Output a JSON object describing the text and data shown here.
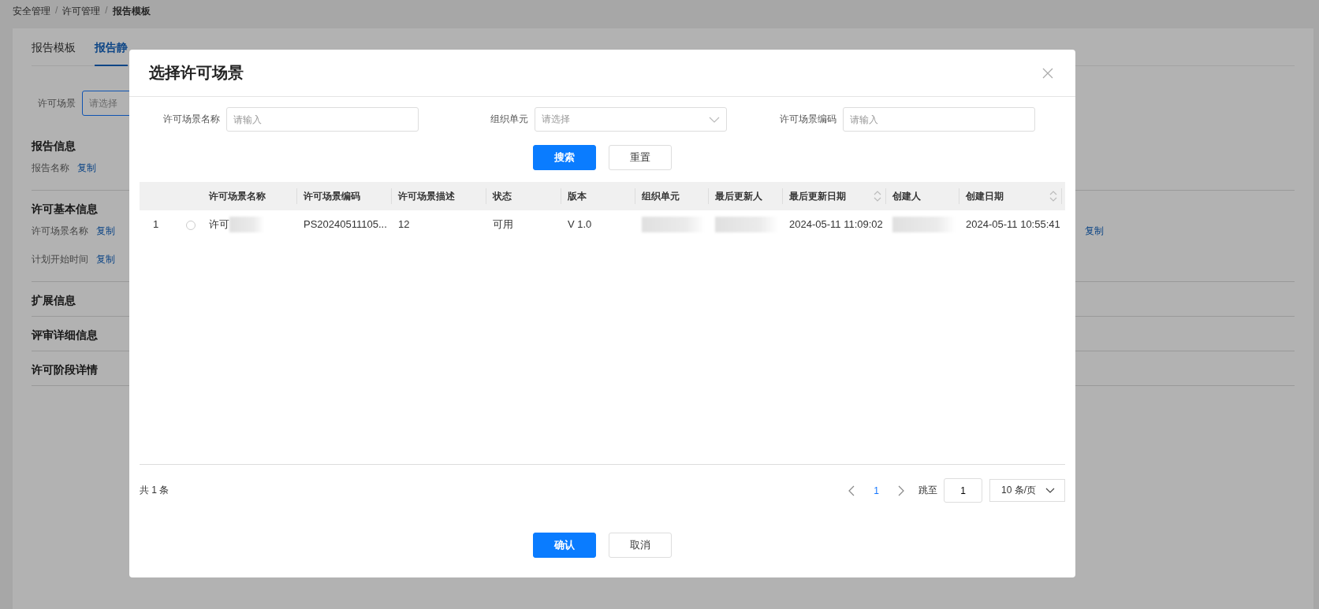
{
  "breadcrumb_separator": "/",
  "breadcrumb": [
    {
      "label": "安全管理",
      "current": false
    },
    {
      "label": "许可管理",
      "current": false
    },
    {
      "label": "报告模板",
      "current": true
    }
  ],
  "tabs": [
    {
      "label": "报告模板",
      "selected": false
    },
    {
      "label": "报告静",
      "selected": true
    }
  ],
  "filter": {
    "label": "许可场景",
    "placeholder": "请选择"
  },
  "sections": [
    {
      "title": "报告信息",
      "rows": [
        [
          {
            "kind": "field",
            "label": "报告名称",
            "link": "复制"
          }
        ]
      ]
    },
    {
      "title": "许可基本信息",
      "rows": [
        [
          {
            "kind": "field",
            "label": "许可场景名称",
            "link": "复制"
          },
          {
            "kind": "link",
            "link": "复制"
          }
        ],
        [
          {
            "kind": "field",
            "label": "计划开始时间",
            "link": "复制"
          }
        ]
      ]
    },
    {
      "title": "扩展信息"
    },
    {
      "title": "评审详细信息"
    },
    {
      "title": "许可阶段详情"
    }
  ],
  "dialog": {
    "title": "选择许可场景",
    "filters": [
      {
        "kind": "input",
        "label": "许可场景名称",
        "placeholder": "请输入"
      },
      {
        "kind": "select",
        "label": "组织单元",
        "placeholder": "请选择"
      },
      {
        "kind": "input",
        "label": "许可场景编码",
        "placeholder": "请输入"
      }
    ],
    "search_button": "搜索",
    "reset_button": "重置",
    "table": {
      "columns": [
        {
          "label": "许可场景名称",
          "sortable": false
        },
        {
          "label": "许可场景编码",
          "sortable": false
        },
        {
          "label": "许可场景描述",
          "sortable": false
        },
        {
          "label": "状态",
          "sortable": false
        },
        {
          "label": "版本",
          "sortable": false
        },
        {
          "label": "组织单元",
          "sortable": false
        },
        {
          "label": "最后更新人",
          "sortable": false
        },
        {
          "label": "最后更新日期",
          "sortable": true
        },
        {
          "label": "创建人",
          "sortable": false
        },
        {
          "label": "创建日期",
          "sortable": true
        }
      ],
      "rows": [
        {
          "index": "1",
          "selected": false,
          "cells": [
            {
              "text": "许可",
              "redacted": true
            },
            {
              "text": "PS20240511105..."
            },
            {
              "text": "12"
            },
            {
              "text": "可用"
            },
            {
              "text": "V 1.0"
            },
            {
              "redacted": true
            },
            {
              "redacted": true
            },
            {
              "text": "2024-05-11 11:09:02"
            },
            {
              "redacted": true
            },
            {
              "text": "2024-05-11 10:55:41"
            }
          ]
        }
      ]
    },
    "total": "共 1 条",
    "pages": [
      {
        "label": "1",
        "selected": true
      }
    ],
    "jump_label": "跳至",
    "jump_value": "1",
    "page_size": "10 条/页",
    "confirm_button": "确认",
    "cancel_button": "取消"
  }
}
